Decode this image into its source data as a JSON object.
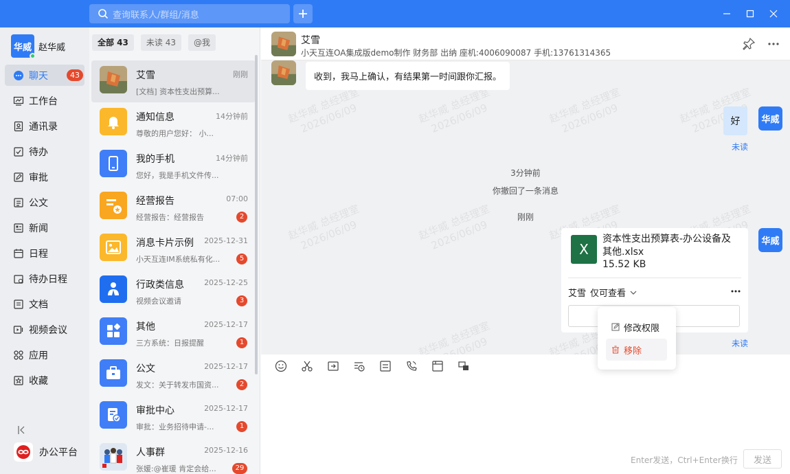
{
  "search": {
    "placeholder": "查询联系人/群组/消息"
  },
  "user": {
    "avatar_text": "华威",
    "name": "赵华威"
  },
  "nav": {
    "items": [
      {
        "label": "聊天",
        "icon": "chat-icon",
        "badge": "43",
        "active": true
      },
      {
        "label": "工作台",
        "icon": "dashboard-icon"
      },
      {
        "label": "通讯录",
        "icon": "contacts-icon"
      },
      {
        "label": "待办",
        "icon": "todo-icon"
      },
      {
        "label": "审批",
        "icon": "approval-icon"
      },
      {
        "label": "公文",
        "icon": "document-icon"
      },
      {
        "label": "新闻",
        "icon": "news-icon"
      },
      {
        "label": "日程",
        "icon": "calendar-icon"
      },
      {
        "label": "待办日程",
        "icon": "todo-calendar-icon"
      },
      {
        "label": "文档",
        "icon": "file-icon"
      },
      {
        "label": "视频会议",
        "icon": "video-icon"
      },
      {
        "label": "应用",
        "icon": "apps-icon"
      },
      {
        "label": "收藏",
        "icon": "star-icon"
      }
    ],
    "platform_label": "办公平台"
  },
  "filters": [
    "全部 43",
    "未读 43",
    "@我"
  ],
  "conversations": [
    {
      "name": "艾雪",
      "time": "刚刚",
      "preview": "[文档] 资本性支出预算...",
      "badge": ""
    },
    {
      "name": "通知信息",
      "time": "14分钟前",
      "preview": "尊敬的用户您好：  小...",
      "badge": ""
    },
    {
      "name": "我的手机",
      "time": "14分钟前",
      "preview": "您好，我是手机文件传...",
      "badge": ""
    },
    {
      "name": "经营报告",
      "time": "07:00",
      "preview": "经营报告：经营报告",
      "badge": "2"
    },
    {
      "name": "消息卡片示例",
      "time": "2025-12-31",
      "preview": "小天互连IM系统私有化...",
      "badge": "5"
    },
    {
      "name": "行政类信息",
      "time": "2025-12-25",
      "preview": "视频会议邀请",
      "badge": "3"
    },
    {
      "name": "其他",
      "time": "2025-12-17",
      "preview": "三方系统：日报提醒",
      "badge": "1"
    },
    {
      "name": "公文",
      "time": "2025-12-17",
      "preview": "发文：关于转发市国资...",
      "badge": "2"
    },
    {
      "name": "审批中心",
      "time": "2025-12-17",
      "preview": "审批：业务招待申请-...",
      "badge": "1"
    },
    {
      "name": "人事群",
      "time": "2025-12-16",
      "preview": "张媛:@崔瑗 肯定会给...",
      "badge": "29"
    }
  ],
  "chat": {
    "name": "艾雪",
    "info": "小天互连OA集成版demo制作 财务部 出纳 座机:4006090087 手机:13761314365",
    "msg1": "收到，我马上确认，有结果第一时间跟你汇报。",
    "self_avatar_text": "华威",
    "msg2": "好",
    "unread": "未读",
    "sys_time": "3分钟前",
    "sys_recall": "你撤回了一条消息",
    "sys_now": "刚刚",
    "file": {
      "name": "资本性支出预算表-办公设备及其他.xlsx",
      "size": "15.52 KB",
      "icon_text": "X",
      "permission_user": "艾雪",
      "permission_level": "仅可查看"
    },
    "watermark": {
      "line1": "赵华威 总经理室",
      "line2": "2026/06/09"
    }
  },
  "dropdown": {
    "edit": "修改权限",
    "remove": "移除"
  },
  "composer": {
    "hint": "Enter发送，Ctrl+Enter换行",
    "send": "发送"
  },
  "colors": {
    "primary": "#2f7bf5",
    "badge": "#e5492d",
    "excel": "#1e7245"
  }
}
